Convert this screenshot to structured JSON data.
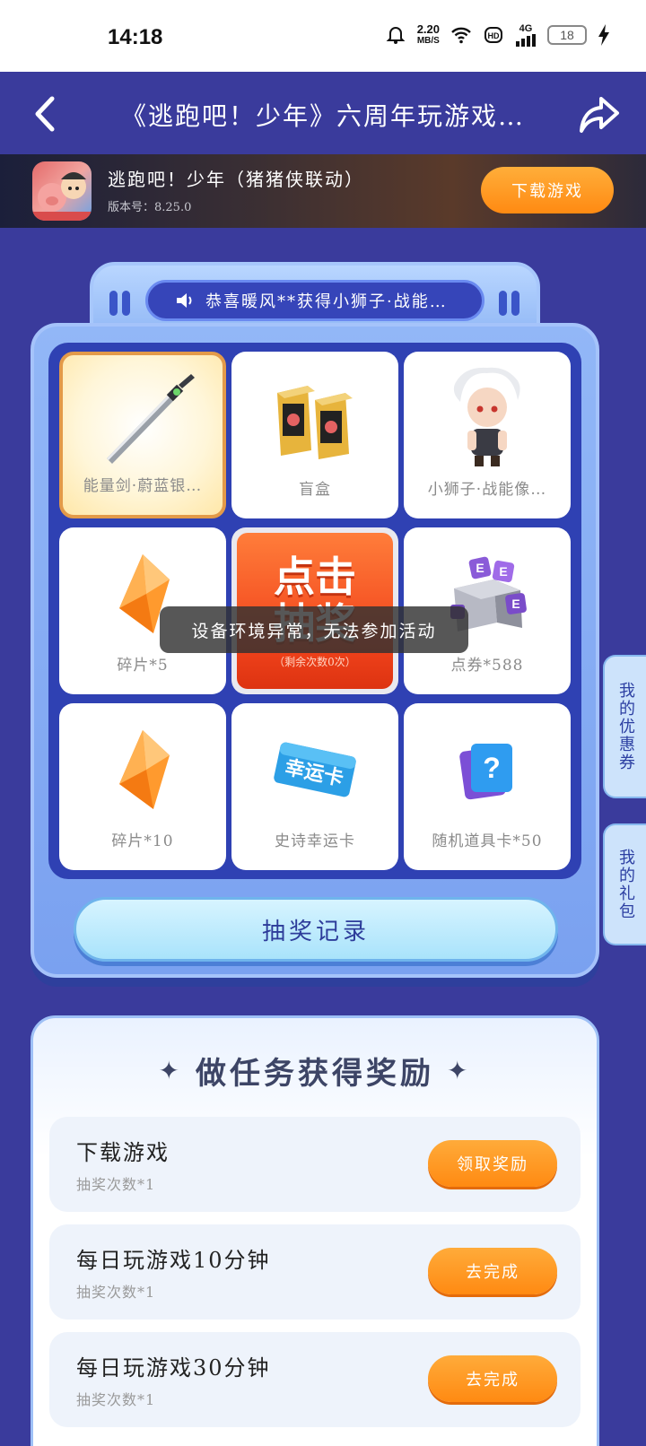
{
  "status_bar": {
    "time": "14:18",
    "net_speed_value": "2.20",
    "net_speed_unit": "MB/S",
    "network": "4G",
    "battery": "18"
  },
  "header": {
    "title": "《逃跑吧！少年》六周年玩游戏…",
    "back_icon": "chevron-left-icon",
    "share_icon": "share-icon"
  },
  "game": {
    "name": "逃跑吧！少年（猪猪侠联动）",
    "version": "版本号：8.25.0",
    "download_label": "下载游戏"
  },
  "marquee": {
    "text": "恭喜暖风**获得小狮子·战能…"
  },
  "prizes": [
    {
      "label": "能量剑·蔚蓝银…",
      "icon": "sword-icon",
      "selected": true
    },
    {
      "label": "盲盒",
      "icon": "blind-box-icon"
    },
    {
      "label": "小狮子·战能像…",
      "icon": "figure-icon"
    },
    {
      "label": "碎片*5",
      "icon": "crystal-icon"
    },
    {
      "label": "点券*588",
      "icon": "coupon-box-icon"
    },
    {
      "label": "碎片*10",
      "icon": "crystal-icon"
    },
    {
      "label": "史诗幸运卡",
      "icon": "lucky-card-icon"
    },
    {
      "label": "随机道具卡*50",
      "icon": "mystery-card-icon"
    }
  ],
  "lucky_card_text": "幸运卡",
  "draw": {
    "line1": "点击",
    "line2": "抽奖",
    "remaining": "（剩余次数0次）"
  },
  "toast": "设备环境异常，无法参加活动",
  "record_label": "抽奖记录",
  "side_tabs": {
    "coupons": "我的优惠券",
    "gifts": "我的礼包"
  },
  "tasks": {
    "title": "做任务获得奖励",
    "items": [
      {
        "name": "下载游戏",
        "reward": "抽奖次数*1",
        "button": "领取奖励"
      },
      {
        "name": "每日玩游戏10分钟",
        "reward": "抽奖次数*1",
        "button": "去完成"
      },
      {
        "name": "每日玩游戏30分钟",
        "reward": "抽奖次数*1",
        "button": "去完成"
      }
    ]
  },
  "colors": {
    "background": "#3a3b9c",
    "accent_orange": "#ff8a12",
    "draw_red": "#f2441c",
    "board_blue": "#2f41b3"
  }
}
